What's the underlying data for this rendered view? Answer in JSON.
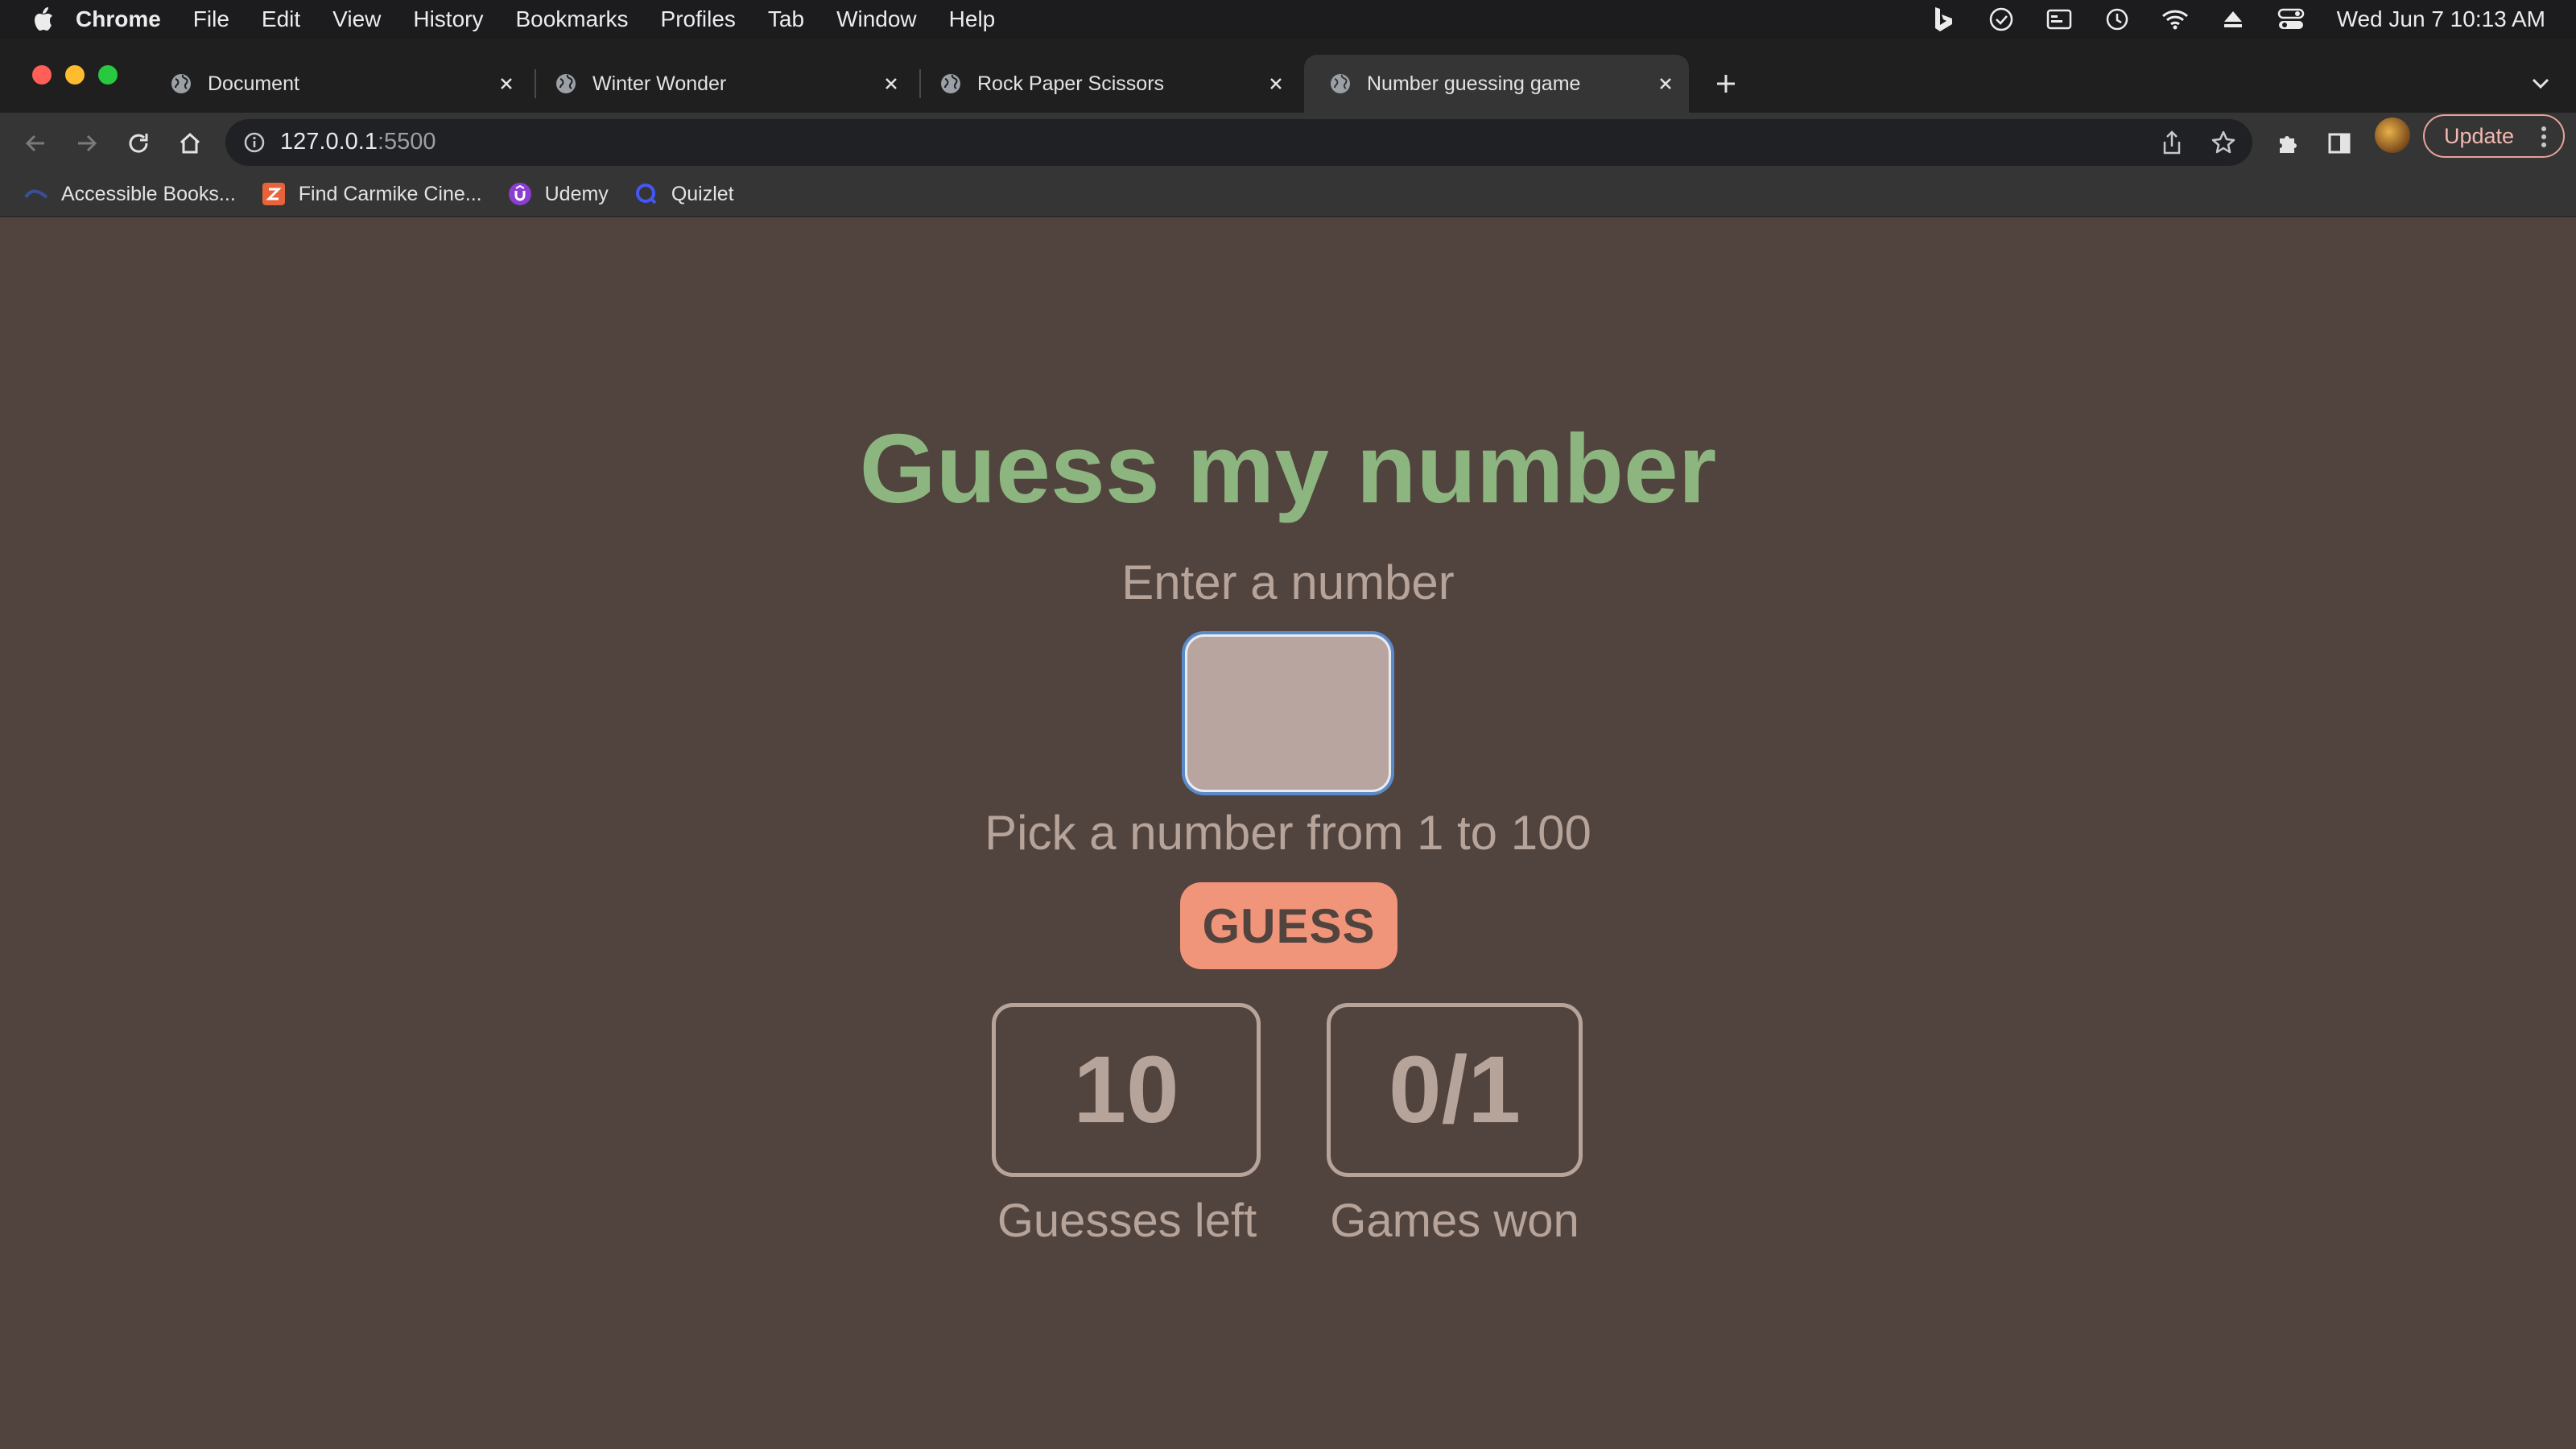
{
  "menubar": {
    "app_name": "Chrome",
    "items": [
      "File",
      "Edit",
      "View",
      "History",
      "Bookmarks",
      "Profiles",
      "Tab",
      "Window",
      "Help"
    ],
    "clock": "Wed Jun 7  10:13 AM"
  },
  "tabs": [
    {
      "title": "Document",
      "active": false
    },
    {
      "title": "Winter Wonder",
      "active": false
    },
    {
      "title": "Rock Paper Scissors",
      "active": false
    },
    {
      "title": "Number guessing game",
      "active": true
    }
  ],
  "address_bar": {
    "host": "127.0.0.1",
    "port": ":5500"
  },
  "update_button": {
    "label": "Update"
  },
  "bookmarks": [
    {
      "label": "Accessible Books...",
      "icon": "accessible-books-icon"
    },
    {
      "label": "Find Carmike Cine...",
      "icon": "carmike-icon"
    },
    {
      "label": "Udemy",
      "icon": "udemy-icon"
    },
    {
      "label": "Quizlet",
      "icon": "quizlet-icon"
    }
  ],
  "game": {
    "title": "Guess my number",
    "input_label": "Enter a number",
    "input_value": "",
    "hint": "Pick a number from 1 to 100",
    "guess_button": "GUESS",
    "guesses_left": "10",
    "guesses_left_label": "Guesses left",
    "games_won": "0/1",
    "games_won_label": "Games won"
  },
  "colors": {
    "page_background": "#51433d",
    "title_green": "#8db580",
    "muted_text": "#b6a399",
    "button_salmon": "#f0957a",
    "input_focus_ring": "#5b8ac9"
  }
}
